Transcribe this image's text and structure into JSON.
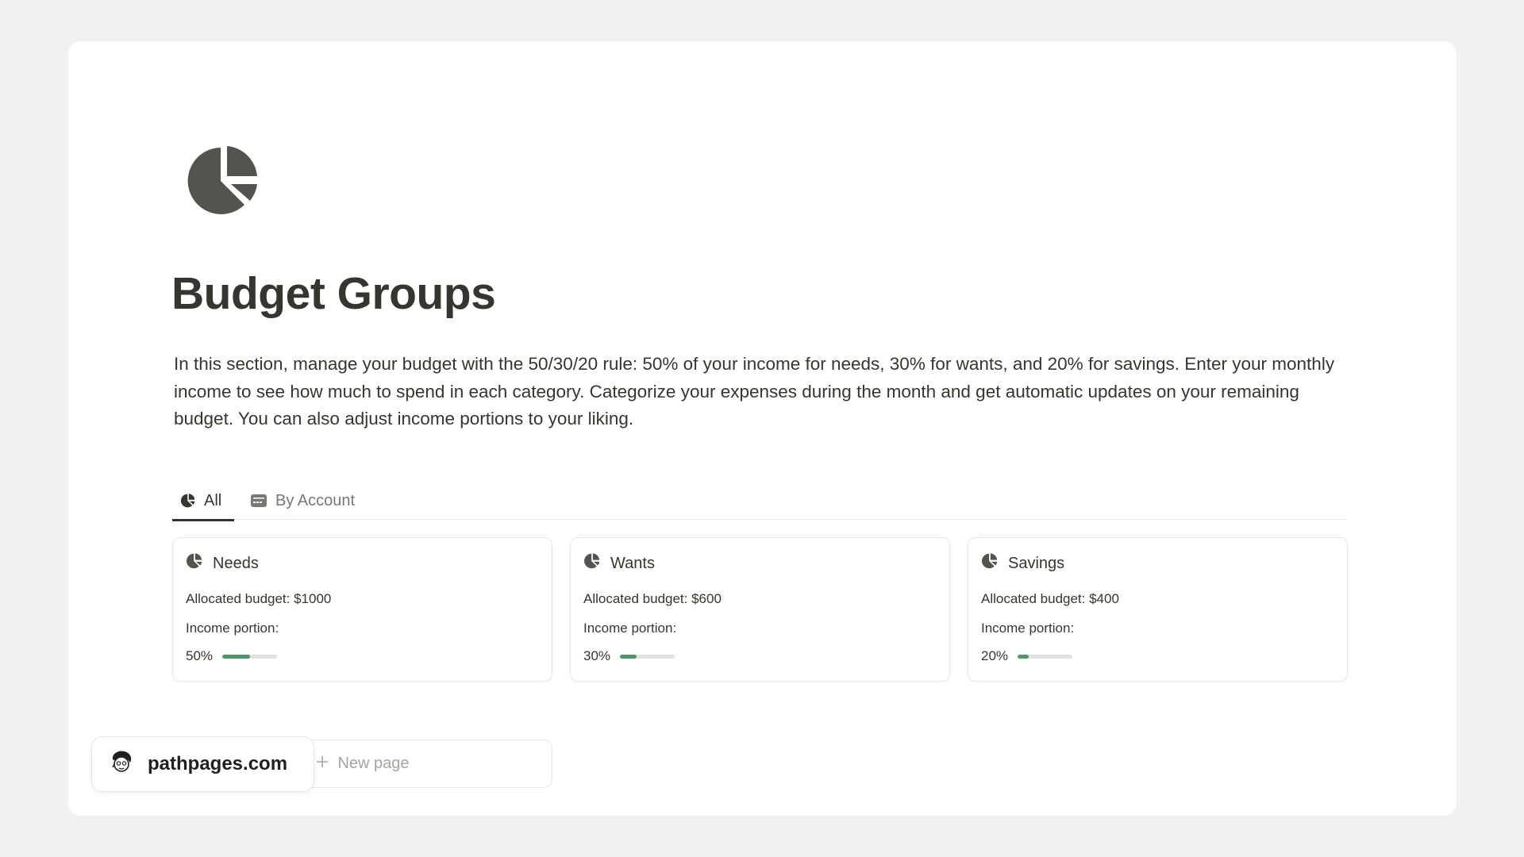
{
  "page": {
    "title": "Budget Groups",
    "icon": "pie-chart-icon",
    "description": "In this section, manage your budget with the 50/30/20 rule: 50% of your income for needs, 30% for wants, and 20% for savings. Enter your monthly income to see how much to spend in each category. Categorize your expenses during the month and get automatic updates on your remaining budget. You can also adjust income portions to your liking."
  },
  "tabs": [
    {
      "label": "All",
      "icon": "pie-chart-icon",
      "active": true
    },
    {
      "label": "By Account",
      "icon": "credit-card-icon",
      "active": false
    }
  ],
  "cards": [
    {
      "name": "Needs",
      "allocated": "Allocated budget: $1000",
      "portion_label": "Income portion:",
      "percent_text": "50%",
      "percent": 50
    },
    {
      "name": "Wants",
      "allocated": "Allocated budget: $600",
      "portion_label": "Income portion:",
      "percent_text": "30%",
      "percent": 30
    },
    {
      "name": "Savings",
      "allocated": "Allocated budget: $400",
      "portion_label": "Income portion:",
      "percent_text": "20%",
      "percent": 20
    }
  ],
  "new_page": {
    "label": "New page"
  },
  "badge": {
    "label": "pathpages.com"
  },
  "colors": {
    "progress": "#4f9768",
    "text": "#37352f",
    "muted": "#787774"
  }
}
